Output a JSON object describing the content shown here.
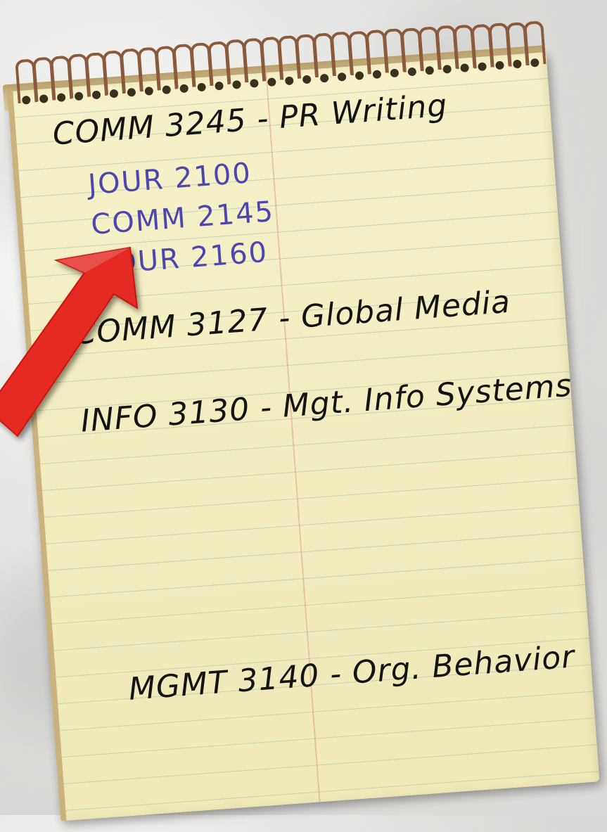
{
  "notepad": {
    "lines": [
      {
        "text": "COMM 3245 - PR Writing",
        "kind": "course"
      },
      {
        "text": "JOUR 2100",
        "kind": "prereq"
      },
      {
        "text": "COMM 2145",
        "kind": "prereq"
      },
      {
        "text": "JOUR 2160",
        "kind": "prereq"
      },
      {
        "text": "COMM 3127 - Global Media",
        "kind": "course"
      },
      {
        "text": "INFO 3130 - Mgt. Info Systems",
        "kind": "course"
      },
      {
        "text": "MGMT 3140 - Org. Behavior",
        "kind": "course"
      }
    ]
  },
  "colors": {
    "paper": "#f4efc2",
    "ink_black": "#141414",
    "ink_blue": "#4d46b0",
    "arrow": "#e42a20",
    "coil": "#8a5a3a"
  },
  "icons": {
    "arrow": "red-arrow-icon"
  }
}
